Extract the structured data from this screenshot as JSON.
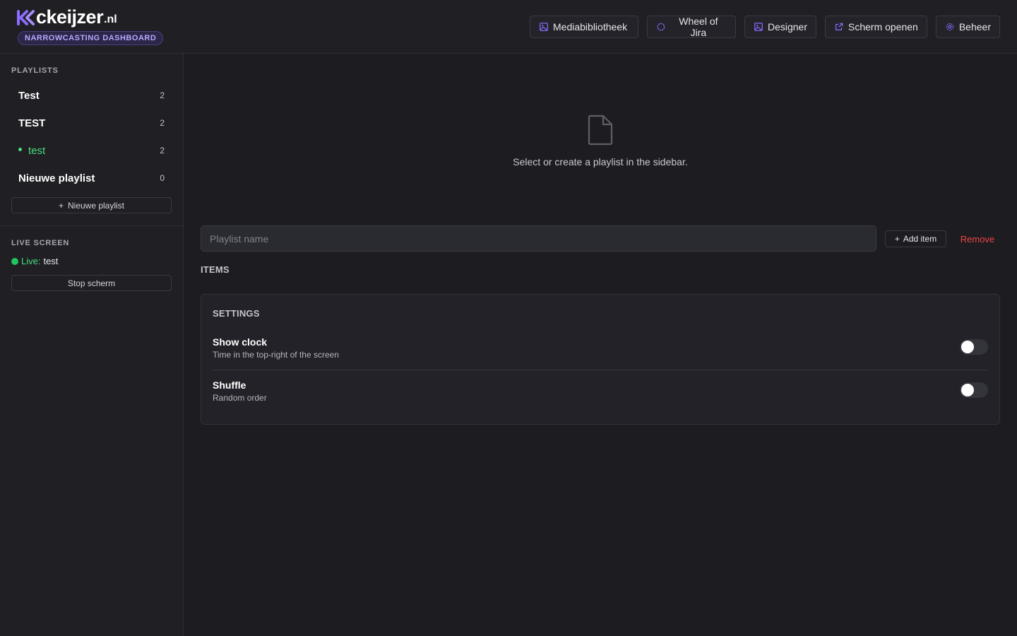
{
  "brand": {
    "name": "ckeijzer",
    "tld": ".nl",
    "badge": "NARROWCASTING DASHBOARD",
    "accent_color": "#8b6cff"
  },
  "nav": [
    {
      "label": "Mediabibliotheek",
      "icon": "image-icon"
    },
    {
      "label": "Wheel of Jira",
      "icon": "circle-icon"
    },
    {
      "label": "Designer",
      "icon": "image-icon"
    },
    {
      "label": "Scherm openen",
      "icon": "external-link-icon"
    },
    {
      "label": "Beheer",
      "icon": "gear-icon"
    }
  ],
  "sidebar": {
    "playlists_title": "PLAYLISTS",
    "playlists": [
      {
        "name": "Test",
        "count": "2",
        "active": false
      },
      {
        "name": "TEST",
        "count": "2",
        "active": false
      },
      {
        "name": "test",
        "count": "2",
        "active": true
      },
      {
        "name": "Nieuwe playlist",
        "count": "0",
        "active": false
      }
    ],
    "new_playlist_label": "Nieuwe playlist",
    "live_title": "LIVE SCREEN",
    "live_label": "Live:",
    "live_value": "test",
    "stop_label": "Stop scherm"
  },
  "main": {
    "empty_message": "Select or create a playlist in the sidebar.",
    "name_placeholder": "Playlist name",
    "add_item_label": "Add item",
    "remove_label": "Remove",
    "items_title": "ITEMS",
    "settings": {
      "title": "SETTINGS",
      "options": [
        {
          "label": "Show clock",
          "description": "Time in the top-right of the screen",
          "enabled": false
        },
        {
          "label": "Shuffle",
          "description": "Random order",
          "enabled": false
        }
      ]
    }
  },
  "colors": {
    "live": "#22c55e",
    "danger": "#ef4444",
    "active_playlist": "#4ade80"
  }
}
